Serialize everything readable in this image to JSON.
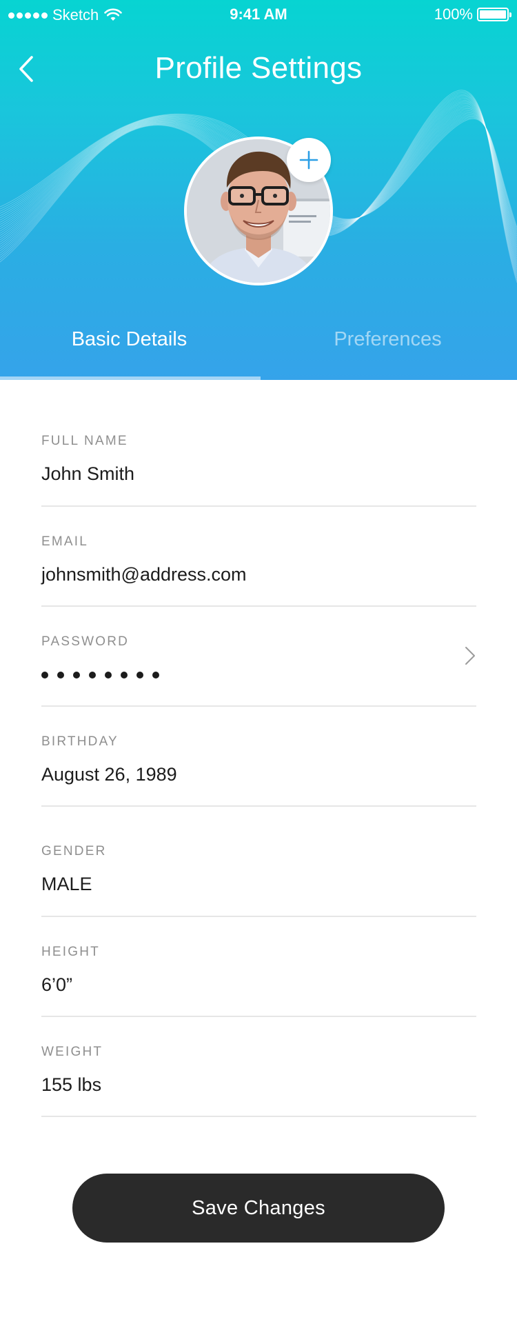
{
  "status_bar": {
    "carrier": "Sketch",
    "time": "9:41 AM",
    "battery": "100%"
  },
  "header": {
    "title": "Profile Settings",
    "back_icon": "chevron-left-icon",
    "add_photo_icon": "plus-icon"
  },
  "tabs": [
    {
      "label": "Basic Details",
      "active": true
    },
    {
      "label": "Preferences",
      "active": false
    }
  ],
  "fields": {
    "full_name": {
      "label": "FULL NAME",
      "value": "John Smith"
    },
    "email": {
      "label": "EMAIL",
      "value": "johnsmith@address.com"
    },
    "password": {
      "label": "PASSWORD",
      "masked_length": 8
    },
    "birthday": {
      "label": "BIRTHDAY",
      "value": "August 26, 1989"
    },
    "gender": {
      "label": "GENDER",
      "value": "MALE"
    },
    "height": {
      "label": "HEIGHT",
      "value": "6’0”"
    },
    "weight": {
      "label": "WEIGHT",
      "value": "155 lbs"
    }
  },
  "save_button": {
    "label": "Save Changes"
  },
  "colors": {
    "header_top": "#07d4d2",
    "header_bottom": "#35a3ea",
    "accent": "#2b9fe6",
    "button": "#2a2a2a"
  }
}
